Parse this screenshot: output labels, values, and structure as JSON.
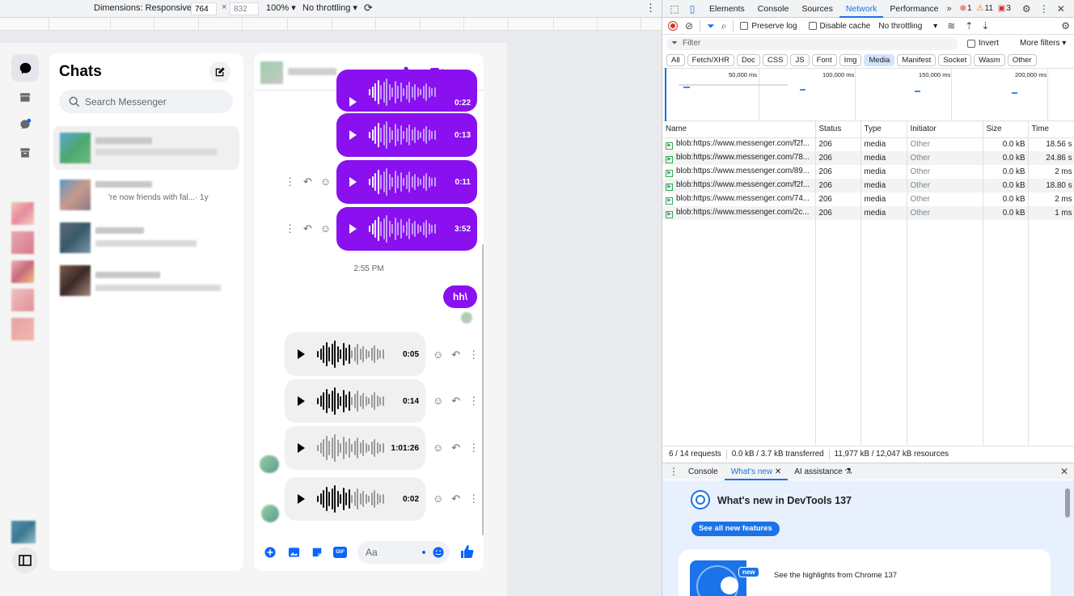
{
  "device_toolbar": {
    "dimensions_label": "Dimensions: Responsive",
    "width": "764",
    "times": "×",
    "height": "832",
    "zoom": "100%",
    "throttling": "No throttling"
  },
  "rail": {
    "icons": [
      "chat-icon",
      "store-icon",
      "message-requests-icon",
      "archive-icon",
      "sidebar-toggle-icon"
    ]
  },
  "chats": {
    "title": "Chats",
    "search_placeholder": "Search Messenger",
    "row2_preview": "'re now friends with fal...",
    "row2_time": "· 1y"
  },
  "conversation": {
    "timestamp": "2:55 PM",
    "sent_text": "hh\\",
    "outgoing_voice": [
      {
        "duration": "0:22"
      },
      {
        "duration": "0:13"
      },
      {
        "duration": "0:11"
      },
      {
        "duration": "3:52"
      }
    ],
    "incoming_voice": [
      {
        "duration": "0:05"
      },
      {
        "duration": "0:14"
      },
      {
        "duration": "1:01:26"
      },
      {
        "duration": "0:02"
      }
    ],
    "composer_placeholder": "Aa",
    "gif_label": "GIF"
  },
  "devtools": {
    "tabs": [
      "Elements",
      "Console",
      "Sources",
      "Network",
      "Performance"
    ],
    "active_tab": "Network",
    "error_count": "1",
    "warning_count": "11",
    "issue_count": "3",
    "preserve_log": "Preserve log",
    "disable_cache": "Disable cache",
    "throttling": "No throttling",
    "filter_placeholder": "Filter",
    "invert": "Invert",
    "more_filters": "More filters",
    "type_filters": [
      "All",
      "Fetch/XHR",
      "Doc",
      "CSS",
      "JS",
      "Font",
      "Img",
      "Media",
      "Manifest",
      "Socket",
      "Wasm",
      "Other"
    ],
    "active_filter": "Media",
    "timeline_ticks": [
      "50,000 ms",
      "100,000 ms",
      "150,000 ms",
      "200,000 ms"
    ],
    "columns": [
      "Name",
      "Status",
      "Type",
      "Initiator",
      "Size",
      "Time"
    ],
    "requests": [
      {
        "name": "blob:https://www.messenger.com/f2f...",
        "status": "206",
        "type": "media",
        "initiator": "Other",
        "size": "0.0 kB",
        "time": "18.56 s"
      },
      {
        "name": "blob:https://www.messenger.com/78...",
        "status": "206",
        "type": "media",
        "initiator": "Other",
        "size": "0.0 kB",
        "time": "24.86 s"
      },
      {
        "name": "blob:https://www.messenger.com/89...",
        "status": "206",
        "type": "media",
        "initiator": "Other",
        "size": "0.0 kB",
        "time": "2 ms"
      },
      {
        "name": "blob:https://www.messenger.com/f2f...",
        "status": "206",
        "type": "media",
        "initiator": "Other",
        "size": "0.0 kB",
        "time": "18.80 s"
      },
      {
        "name": "blob:https://www.messenger.com/74...",
        "status": "206",
        "type": "media",
        "initiator": "Other",
        "size": "0.0 kB",
        "time": "2 ms"
      },
      {
        "name": "blob:https://www.messenger.com/2c...",
        "status": "206",
        "type": "media",
        "initiator": "Other",
        "size": "0.0 kB",
        "time": "1 ms"
      }
    ],
    "status_bar": {
      "requests": "6 / 14 requests",
      "transferred": "0.0 kB / 3.7 kB transferred",
      "resources": "11,977 kB / 12,047 kB resources"
    },
    "drawer": {
      "tabs": [
        "Console",
        "What's new",
        "AI assistance"
      ],
      "active": "What's new",
      "heading": "What's new in DevTools 137",
      "button": "See all new features",
      "card_badge": "new",
      "card_text": "See the highlights from Chrome 137"
    }
  },
  "colors": {
    "messenger_purple": "#8a10f0",
    "accent_blue": "#1a73e8",
    "messenger_blue": "#0866ff"
  }
}
